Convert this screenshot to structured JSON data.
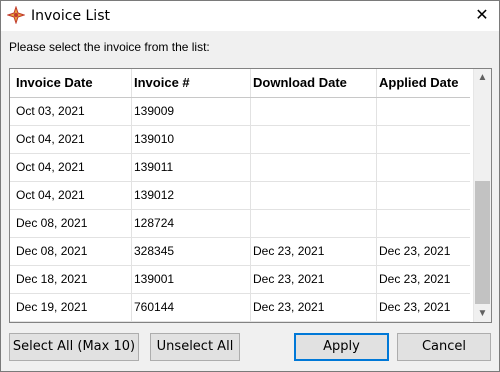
{
  "window": {
    "title": "Invoice List",
    "close_glyph": "✕"
  },
  "prompt": "Please select the invoice from the list:",
  "columns": [
    "Invoice Date",
    "Invoice #",
    "Download Date",
    "Applied Date"
  ],
  "rows": [
    [
      "Oct 03, 2021",
      "139009",
      "",
      ""
    ],
    [
      "Oct 04, 2021",
      "139010",
      "",
      ""
    ],
    [
      "Oct 04, 2021",
      "139011",
      "",
      ""
    ],
    [
      "Oct 04, 2021",
      "139012",
      "",
      ""
    ],
    [
      "Dec 08, 2021",
      "128724",
      "",
      ""
    ],
    [
      "Dec 08, 2021",
      "328345",
      "Dec 23, 2021",
      "Dec 23, 2021"
    ],
    [
      "Dec 18, 2021",
      "139001",
      "Dec 23, 2021",
      "Dec 23, 2021"
    ],
    [
      "Dec 19, 2021",
      "760144",
      "Dec 23, 2021",
      "Dec 23, 2021"
    ]
  ],
  "buttons": {
    "select_all": "Select All (Max 10)",
    "unselect_all": "Unselect All",
    "apply": "Apply",
    "cancel": "Cancel"
  },
  "scrollbar": {
    "up_glyph": "▲",
    "down_glyph": "▼"
  },
  "icons": {
    "app": "app-icon",
    "close": "close-icon"
  }
}
